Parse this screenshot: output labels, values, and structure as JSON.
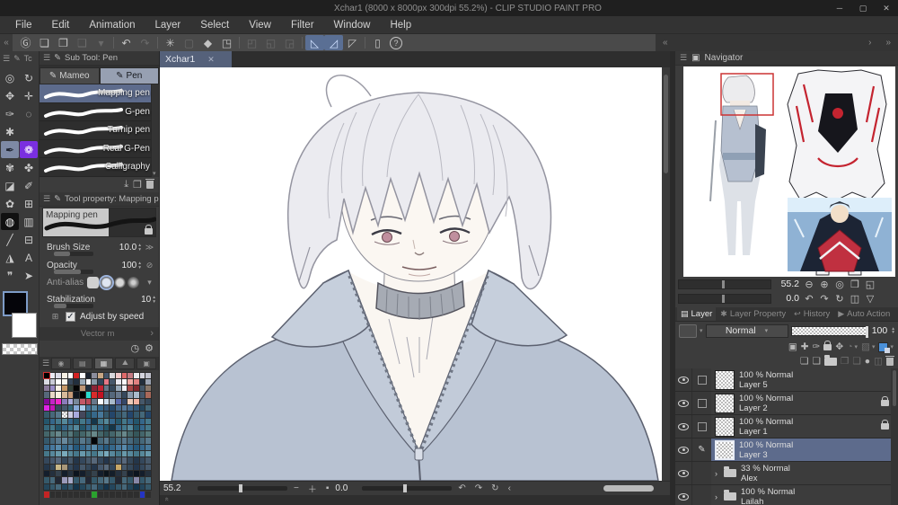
{
  "window": {
    "title": "Xchar1 (8000 x 8000px 300dpi 55.2%) - CLIP STUDIO PAINT PRO",
    "minimize": "─",
    "maximize": "▢",
    "close": "✕"
  },
  "menu": [
    "File",
    "Edit",
    "Animation",
    "Layer",
    "Select",
    "View",
    "Filter",
    "Window",
    "Help"
  ],
  "icons": {
    "burger": "☰",
    "pen_small": "✎",
    "chevrons_left": "«",
    "chevrons_right": "»",
    "chevron_left": "‹",
    "chevron_right": "›",
    "chevron_down": "▾",
    "chevron_up": "▴",
    "zoom_out": "⊖",
    "zoom_in": "⊕",
    "actual_size": "◎",
    "fit_screen": "❒",
    "fit_window": "◱",
    "rotate_ccw": "↶",
    "rotate_cw": "↷",
    "reset_rotation": "↻",
    "flip_h": "◫",
    "flip_v": "▽",
    "minus": "−",
    "plus": "＋",
    "stop": "▪",
    "import": "⤓",
    "duplicate": "❐",
    "wrench": "⚙",
    "dial": "◷",
    "tc_label": "Tc"
  },
  "toolbar_icons": [
    {
      "name": "clip-studio-logo",
      "glyph": "Ⓖ",
      "state": "normal"
    },
    {
      "name": "new-canvas",
      "glyph": "❏",
      "state": "normal"
    },
    {
      "name": "open-file",
      "glyph": "❐",
      "state": "normal"
    },
    {
      "name": "save-file",
      "glyph": "❑",
      "state": "disabled"
    },
    {
      "name": "save-dropdown",
      "glyph": "▾",
      "state": "disabled"
    },
    {
      "name": "sep",
      "glyph": "",
      "state": "sep"
    },
    {
      "name": "undo",
      "glyph": "↶",
      "state": "normal"
    },
    {
      "name": "redo",
      "glyph": "↷",
      "state": "disabled"
    },
    {
      "name": "sep",
      "glyph": "",
      "state": "sep"
    },
    {
      "name": "clear",
      "glyph": "✳",
      "state": "normal"
    },
    {
      "name": "fill",
      "glyph": "▢",
      "state": "disabled"
    },
    {
      "name": "deselect",
      "glyph": "◆",
      "state": "normal"
    },
    {
      "name": "crop-frame",
      "glyph": "◳",
      "state": "normal"
    },
    {
      "name": "sep",
      "glyph": "",
      "state": "sep"
    },
    {
      "name": "selection-launcher",
      "glyph": "◰",
      "state": "disabled"
    },
    {
      "name": "invert-selection",
      "glyph": "◱",
      "state": "disabled"
    },
    {
      "name": "selection-border",
      "glyph": "◲",
      "state": "disabled"
    },
    {
      "name": "sep",
      "glyph": "",
      "state": "sep"
    },
    {
      "name": "snap-to-ruler",
      "glyph": "◺",
      "state": "active"
    },
    {
      "name": "snap-to-special-ruler",
      "glyph": "◿",
      "state": "active"
    },
    {
      "name": "snap-to-grid",
      "glyph": "◸",
      "state": "normal"
    },
    {
      "name": "sep",
      "glyph": "",
      "state": "sep"
    },
    {
      "name": "tablet-settings",
      "glyph": "▯",
      "state": "normal"
    },
    {
      "name": "help",
      "glyph": "?",
      "state": "circle"
    }
  ],
  "tools": [
    {
      "name": "zoom-tool",
      "glyph": "◎",
      "state": "normal"
    },
    {
      "name": "rotate-canvas-tool",
      "glyph": "↻",
      "state": "normal"
    },
    {
      "name": "operation-tool",
      "glyph": "✥",
      "state": "normal"
    },
    {
      "name": "move-tool",
      "glyph": "✛",
      "state": "normal"
    },
    {
      "name": "eyedropper-tool",
      "glyph": "✑",
      "state": "normal"
    },
    {
      "name": "selection-area-tool",
      "glyph": "◌",
      "state": "normal"
    },
    {
      "name": "auto-select-tool",
      "glyph": "✱",
      "state": "normal"
    },
    {
      "name": "blank",
      "glyph": "",
      "state": "blank"
    },
    {
      "name": "pen-tool",
      "glyph": "✒",
      "state": "selected"
    },
    {
      "name": "decoration-tool",
      "glyph": "❁",
      "state": "purple"
    },
    {
      "name": "brush-tool",
      "glyph": "✾",
      "state": "normal"
    },
    {
      "name": "airbrush-tool",
      "glyph": "✤",
      "state": "normal"
    },
    {
      "name": "eraser-tool",
      "glyph": "◪",
      "state": "normal"
    },
    {
      "name": "blend-tool",
      "glyph": "✐",
      "state": "normal"
    },
    {
      "name": "ribbon-tool",
      "glyph": "✿",
      "state": "normal"
    },
    {
      "name": "mesh-tool",
      "glyph": "⊞",
      "state": "normal"
    },
    {
      "name": "fill-tool",
      "glyph": "◍",
      "state": "dark"
    },
    {
      "name": "gradient-tool",
      "glyph": "▥",
      "state": "normal"
    },
    {
      "name": "line-tool",
      "glyph": "╱",
      "state": "normal"
    },
    {
      "name": "frame-border-tool",
      "glyph": "⊟",
      "state": "normal"
    },
    {
      "name": "figure-tool",
      "glyph": "◮",
      "state": "normal"
    },
    {
      "name": "text-tool",
      "glyph": "A",
      "state": "normal"
    },
    {
      "name": "balloon-tool",
      "glyph": "❞",
      "state": "normal"
    },
    {
      "name": "object-tool",
      "glyph": "➤",
      "state": "normal"
    }
  ],
  "subtool": {
    "header": "Sub Tool: Pen",
    "tabs": [
      {
        "label": "Mameo"
      },
      {
        "label": "Pen"
      }
    ],
    "active_tab": "Pen",
    "pens": [
      "Mapping pen",
      "G-pen",
      "Turnip pen",
      "Real G-Pen",
      "Calligraphy"
    ],
    "selected_pen": "Mapping pen"
  },
  "tool_property": {
    "header": "Tool property: Mapping pen",
    "brush_name": "Mapping pen",
    "rows": [
      {
        "label": "Brush Size",
        "value": "10.0"
      },
      {
        "label": "Opacity",
        "value": "100"
      },
      {
        "label": "Anti-alias",
        "value": ""
      },
      {
        "label": "Stabilization",
        "value": "10"
      }
    ],
    "checkbox_label": "Adjust by speed",
    "checkbox_checked": "✓",
    "vector_label": "Vector m"
  },
  "canvas": {
    "tab_label": "Xchar1"
  },
  "status_bar": {
    "zoom": "55.2",
    "rotation": "0.0"
  },
  "navigator": {
    "title": "Navigator",
    "zoom_value": "55.2",
    "rotate_value": "0.0"
  },
  "layer_panel": {
    "tabs": [
      {
        "label": "Layer",
        "icon": "▤",
        "active": true
      },
      {
        "label": "Layer Property",
        "icon": "✱",
        "active": false
      },
      {
        "label": "History",
        "icon": "↩",
        "active": false
      },
      {
        "label": "Auto Action",
        "icon": "▶",
        "active": false
      }
    ],
    "blend_mode": "Normal",
    "opacity_value": "100",
    "icon_row1": [
      {
        "name": "clip-to-layer-below",
        "glyph": "▣",
        "state": "normal"
      },
      {
        "name": "enable-keyframes",
        "glyph": "✚",
        "state": "normal"
      },
      {
        "name": "onion-skin",
        "glyph": "✑",
        "state": "normal"
      },
      {
        "name": "lock-layer",
        "glyph": "LOCK",
        "state": "normal"
      },
      {
        "name": "lock-transparent-pixels",
        "glyph": "✥",
        "state": "normal"
      },
      {
        "name": "create-selection",
        "glyph": "◔",
        "state": "dim",
        "dd": true
      },
      {
        "name": "create-mask",
        "glyph": "▨",
        "state": "dim",
        "dd": true
      },
      {
        "name": "layer-color",
        "glyph": "BLUE",
        "state": "normal",
        "dd": true
      }
    ],
    "icon_row2": [
      {
        "name": "new-raster-layer",
        "glyph": "❏",
        "state": "normal"
      },
      {
        "name": "new-layer-dialog",
        "glyph": "❏",
        "state": "normal"
      },
      {
        "name": "new-layer-folder",
        "glyph": "FOLDER",
        "state": "normal"
      },
      {
        "name": "transfer-to-lower-layer",
        "glyph": "❐",
        "state": "dim"
      },
      {
        "name": "merge-with-lower-layer",
        "glyph": "❑",
        "state": "dim"
      },
      {
        "name": "layer-mask",
        "glyph": "●",
        "state": "normal"
      },
      {
        "name": "divide-layer",
        "glyph": "◫",
        "state": "dim"
      },
      {
        "name": "delete-layer",
        "glyph": "TRASH",
        "state": "normal"
      }
    ],
    "layers": [
      {
        "info": "100 % Normal",
        "name": "Layer 5",
        "type": "layer",
        "locked": false,
        "selected": false,
        "editing": false
      },
      {
        "info": "100 % Normal",
        "name": "Layer 2",
        "type": "layer",
        "locked": true,
        "selected": false,
        "editing": false
      },
      {
        "info": "100 % Normal",
        "name": "Layer 1",
        "type": "layer",
        "locked": true,
        "selected": false,
        "editing": false
      },
      {
        "info": "100 % Normal",
        "name": "Layer 3",
        "type": "layer",
        "locked": false,
        "selected": true,
        "editing": true
      },
      {
        "info": "33 % Normal",
        "name": "Alex",
        "type": "folder",
        "locked": false,
        "selected": false,
        "editing": false
      },
      {
        "info": "100 % Normal",
        "name": "Lailah",
        "type": "folder",
        "locked": false,
        "selected": false,
        "editing": false
      }
    ]
  },
  "palette": {
    "rows": [
      [
        "#000000",
        "#e9e9f2",
        "#dcdce8",
        "#f7f0e4",
        "#ffffff",
        "#d42222",
        "#ffffff",
        "#1d2430",
        "#8b8d9c",
        "#c7a684",
        "#45556a",
        "#d8d8dc",
        "#f2c9c9",
        "#e06a6a",
        "#c47a82",
        "#ebebee",
        "#d5d5de",
        "#c3c4cf"
      ],
      [
        "#dadae2",
        "#c9cad6",
        "#ffffff",
        "#f8f6ee",
        "#37475a",
        "#222f3e",
        "#9aaab8",
        "#f4f4f6",
        "#8a9aa8",
        "#32455a",
        "#e57886",
        "#46586c",
        "#e8e9f2",
        "#fbfbfd",
        "#f2a8a2",
        "#e28080",
        "#232f3d",
        "#9aa2b2"
      ],
      [
        "#8a7a9a",
        "#9a8cc8",
        "#f8f0e6",
        "#c89a68",
        "#33413b",
        "#050505",
        "#bf9878",
        "#22303e",
        "#8a2436",
        "#c42434",
        "#66788a",
        "#35485c",
        "#98aabb",
        "#eff0f6",
        "#a84646",
        "#84262c",
        "#46586a",
        "#88776a"
      ],
      [
        "#56687a",
        "#e8d8c6",
        "#f8f0de",
        "#d8ba9a",
        "#c69a78",
        "#10161e",
        "#000000",
        "#28d8cc",
        "#d82a2a",
        "#c21222",
        "#44566a",
        "#56687c",
        "#68788c",
        "#36485c",
        "#8a9aac",
        "#aabbcb",
        "#46586c",
        "#a8685a"
      ],
      [
        "#85089a",
        "#c424c8",
        "#f026c8",
        "#8a7cba",
        "#a8aada",
        "#78889a",
        "#c45868",
        "#b64858",
        "#68788a",
        "#fcfcfe",
        "#cbdcec",
        "#a8bacb",
        "#5868aa",
        "#354868",
        "#eccab8",
        "#f2b2a2",
        "#46586a",
        "#35485a"
      ],
      [
        "#e224e8",
        "#c214b8",
        "#35485c",
        "#46586c",
        "#36687a",
        "#88aad8",
        "#aaccec",
        "#4878a0",
        "#5888a2",
        "#36688c",
        "#35587a",
        "#24486a",
        "#44688c",
        "#55789a",
        "#44688a",
        "#35587a",
        "#24455c",
        "#446878"
      ],
      [
        "#35596a",
        "#46687a",
        "#57788c",
        "CHECKER",
        "#cccce2",
        "#a8aade",
        "#44485c",
        "#25586c",
        "#36688a",
        "#47789a",
        "#35586a",
        "#24466a",
        "#35586c",
        "#44687c",
        "#24466c",
        "#35586c",
        "#44687a",
        "#24466a"
      ],
      [
        "#24566c",
        "#35678a",
        "#44788c",
        "#55889a",
        "#35678a",
        "#24566c",
        "#44788a",
        "#35678c",
        "#15364a",
        "#44788c",
        "#55889a",
        "#35678a",
        "#24566a",
        "#44788a",
        "#35678a",
        "#24566c",
        "#35678a",
        "#44788c"
      ],
      [
        "#35677a",
        "#44788a",
        "#24566a",
        "#35678a",
        "#44788c",
        "#55889c",
        "#24566a",
        "#35678a",
        "#44788a",
        "#35678a",
        "#24566a",
        "#153648",
        "#35678a",
        "#44788c",
        "#55889a",
        "#24566a",
        "#35678a",
        "#44788a"
      ],
      [
        "#44666a",
        "#55787a",
        "#68888c",
        "#44666c",
        "#55787c",
        "#35565a",
        "#44666a",
        "#55787a",
        "#68888a",
        "#44666a",
        "#35565c",
        "#44666c",
        "#55787a",
        "#68888c",
        "#44666a",
        "#35565a",
        "#44666c",
        "#55787a"
      ],
      [
        "#35596c",
        "#46687c",
        "#57788e",
        "#68899e",
        "#46687a",
        "#35596a",
        "#57788c",
        "#46687c",
        "#020508",
        "#46687a",
        "#57788c",
        "#35596c",
        "#46687a",
        "#57788e",
        "#46687c",
        "#35596a",
        "#46687a",
        "#57788c"
      ],
      [
        "#36688c",
        "#47789e",
        "#588aac",
        "#36688a",
        "#47789c",
        "#25587a",
        "#36688c",
        "#47789a",
        "#588aaa",
        "#36688c",
        "#25587c",
        "#36688a",
        "#47789c",
        "#588aac",
        "#36688a",
        "#25587a",
        "#36688c",
        "#47789a"
      ],
      [
        "#46788a",
        "#57889c",
        "#6899aa",
        "#79aabb",
        "#57889a",
        "#46788c",
        "#6899ac",
        "#57889a",
        "#46788a",
        "#6899aa",
        "#79aabc",
        "#57889c",
        "#46788a",
        "#6899aa",
        "#57889c",
        "#46788a",
        "#57889a",
        "#6899ac"
      ],
      [
        "#35485c",
        "#46586c",
        "#57687c",
        "#35485a",
        "#46586a",
        "#24364a",
        "#35485c",
        "#46586a",
        "#57687a",
        "#35485c",
        "#24364c",
        "#35485a",
        "#46586c",
        "#57687c",
        "#35485a",
        "#24364a",
        "#35485c",
        "#46586a"
      ],
      [
        "#24364a",
        "#35485a",
        "#c8b888",
        "#a8987a",
        "#35485c",
        "#24364c",
        "#46586a",
        "#35485a",
        "#24364a",
        "#46586c",
        "#57687a",
        "#35485c",
        "#c8a868",
        "#46586a",
        "#35485a",
        "#24364c",
        "#35485c",
        "#46586a"
      ],
      [
        "#141e2c",
        "#24303e",
        "#35424e",
        "#141e2a",
        "#24303c",
        "#0c141e",
        "#141e2c",
        "#24303a",
        "#35424c",
        "#141e2c",
        "#0c141c",
        "#141e2a",
        "#24303e",
        "#35424e",
        "#141e2a",
        "#0c141e",
        "#141e2c",
        "#24303c"
      ],
      [
        "#35596a",
        "#46687a",
        "#222834",
        "#9a9aba",
        "#a8aac8",
        "#35596c",
        "#46687c",
        "#222836",
        "#35596a",
        "#46687a",
        "#57788a",
        "#35596c",
        "#222834",
        "#46687a",
        "#35596a",
        "#8888a8",
        "#35596c",
        "#46687a"
      ],
      [
        "#24465a",
        "#35586a",
        "#46687a",
        "#24465c",
        "#35586c",
        "#14344a",
        "#24465a",
        "#35586a",
        "#46687c",
        "#24465a",
        "#14344c",
        "#24465c",
        "#35586a",
        "#46687a",
        "#24465a",
        "#14344a",
        "#24465c",
        "#35586a"
      ]
    ],
    "bottom_row": [
      "#c42424",
      "",
      "",
      "",
      "",
      "",
      "",
      "",
      "#2aa22e",
      "",
      "",
      "",
      "",
      "",
      "",
      "",
      "#2434c4",
      ""
    ]
  },
  "colors": {
    "accent_blue": "#5a6f94",
    "selection_blue": "#5d6b8c",
    "layer_color_blue": "#4a90d9",
    "jacket": "#b8c2d2",
    "skin": "#faf6f1",
    "hair": "#ebebf0",
    "choker": "#a6abb4",
    "nav_view_rect": "#cc3333"
  }
}
